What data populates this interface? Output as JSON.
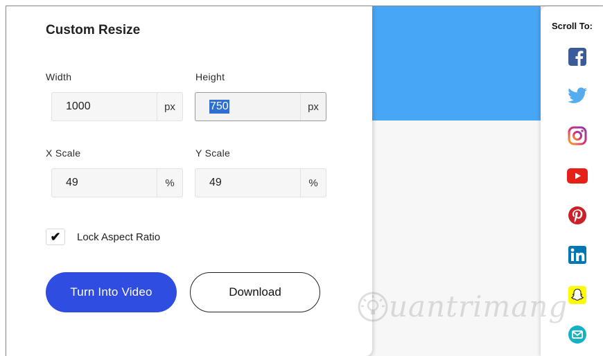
{
  "panel": {
    "title": "Custom Resize",
    "width": {
      "label": "Width",
      "value": "1000",
      "unit": "px"
    },
    "height": {
      "label": "Height",
      "value": "750",
      "unit": "px"
    },
    "x_scale": {
      "label": "X Scale",
      "value": "49",
      "unit": "%"
    },
    "y_scale": {
      "label": "Y Scale",
      "value": "49",
      "unit": "%"
    },
    "lock": {
      "label": "Lock Aspect Ratio",
      "checked": true,
      "check_glyph": "✔"
    },
    "primary_button": "Turn Into Video",
    "secondary_button": "Download"
  },
  "sidebar": {
    "title": "Scroll To:",
    "icons": [
      "facebook-icon",
      "twitter-icon",
      "instagram-icon",
      "youtube-icon",
      "pinterest-icon",
      "linkedin-icon",
      "snapchat-icon",
      "email-icon"
    ]
  },
  "watermark": {
    "text": "uantrimang"
  },
  "colors": {
    "banner_blue": "#47a6f5",
    "primary_button": "#2f4de0",
    "selection": "#2f6fd1"
  }
}
